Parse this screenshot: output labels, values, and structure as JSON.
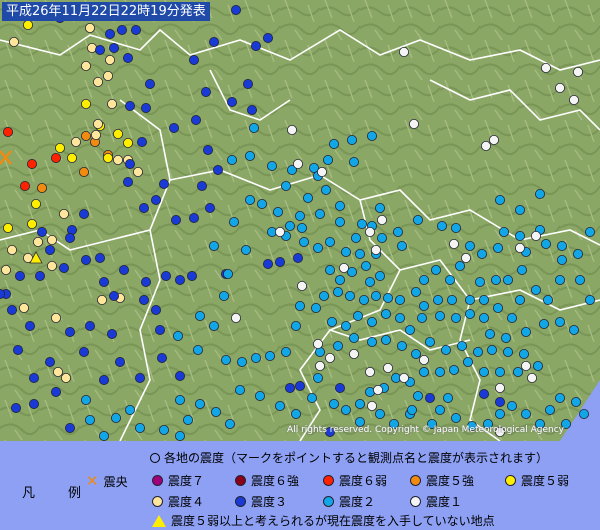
{
  "header": {
    "title": "平成26年11月22日22時19分発表"
  },
  "copyright": "All rights reserved. Copyright © Japan Meteorological Agency",
  "legend": {
    "title": "凡　例",
    "note": "各地の震度（マークをポイントすると観測点名と震度が表示されます）",
    "epicenter_label": "震央",
    "items": [
      {
        "label": "震度７",
        "color": "#a0007a"
      },
      {
        "label": "震度６強",
        "color": "#8a0018"
      },
      {
        "label": "震度６弱",
        "color": "#ff2200"
      },
      {
        "label": "震度５強",
        "color": "#f08a10"
      },
      {
        "label": "震度５弱",
        "color": "#ffee00"
      },
      {
        "label": "震度４",
        "color": "#ffe69a"
      },
      {
        "label": "震度３",
        "color": "#1a3ad6"
      },
      {
        "label": "震度２",
        "color": "#12a6e6"
      },
      {
        "label": "震度１",
        "color": "#f4f4f4"
      }
    ],
    "triangle_label": "震度５弱以上と考えられるが現在震度を入手していない地点",
    "triangle_color": "#ffee00",
    "epicenter_color": "#f08a10"
  },
  "map": {
    "land_color": "#8fa968",
    "sea_color": "#8da0f4"
  }
}
